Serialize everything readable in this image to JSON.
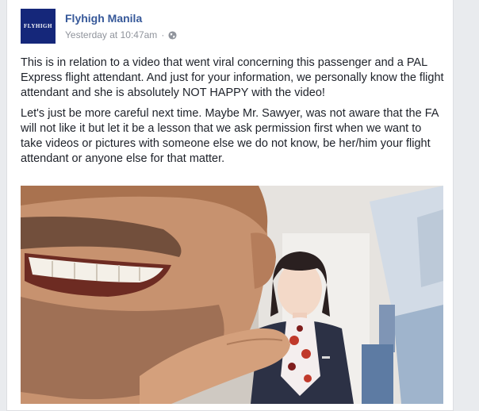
{
  "post": {
    "page_name": "Flyhigh Manila",
    "avatar_text": "FLYHIGH",
    "timestamp": "Yesterday at 10:47am",
    "separator": "·",
    "privacy_icon": "globe-icon",
    "paragraphs": [
      "This is in relation to a video that went viral concerning this passenger and a PAL Express flight attendant. And just for your information, we personally know the flight attendant and she is absolutely NOT HAPPY with the video!",
      "Let's just be more careful next time. Maybe Mr. Sawyer, was not aware that the FA will not like it but let it be a lesson that we ask permission first when we want to take videos or pictures with someone else we do not know, be her/him your flight attendant or anyone else for that matter."
    ]
  },
  "colors": {
    "link": "#365899",
    "meta": "#90949c",
    "text": "#1d2129",
    "avatar_bg": "#15277a",
    "page_bg": "#e9ebee"
  }
}
